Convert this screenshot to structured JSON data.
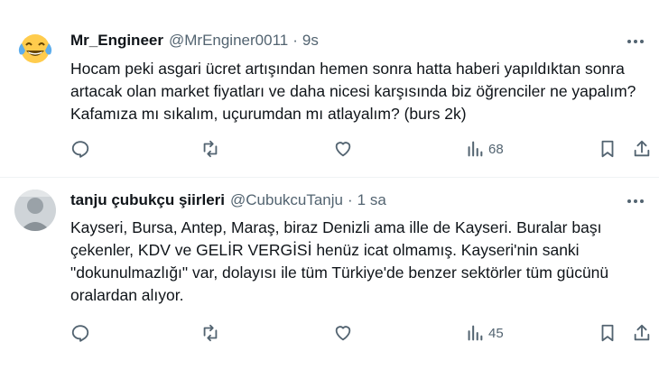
{
  "colors": {
    "text_primary": "#0f1419",
    "text_secondary": "#536471",
    "divider": "#eff3f4",
    "background": "#ffffff"
  },
  "tweets": [
    {
      "display_name": "Mr_Engineer",
      "handle": "@MrEnginer0011",
      "separator": "·",
      "time": "9s",
      "avatar_icon": "laughing-crying-emoji",
      "text": "Hocam peki asgari ücret artışından hemen sonra hatta haberi yapıldıktan sonra artacak olan market fiyatları ve daha nicesi karşısında biz öğrenciler ne yapalım? Kafamıza mı sıkalım, uçurumdan mı atlayalım? (burs 2k)",
      "views": "68"
    },
    {
      "display_name": "tanju çubukçu şiirleri",
      "handle": "@CubukcuTanju",
      "separator": "·",
      "time": "1 sa",
      "avatar_icon": "grey-photo-avatar",
      "text": "Kayseri, Bursa, Antep, Maraş, biraz Denizli ama ille de Kayseri. Buralar başı çekenler, KDV ve GELİR VERGİSİ henüz icat olmamış. Kayseri'nin sanki \"dokunulmazlığı\" var, dolayısı ile tüm Türkiye'de benzer sektörler tüm gücünü oralardan alıyor.",
      "views": "45"
    }
  ]
}
